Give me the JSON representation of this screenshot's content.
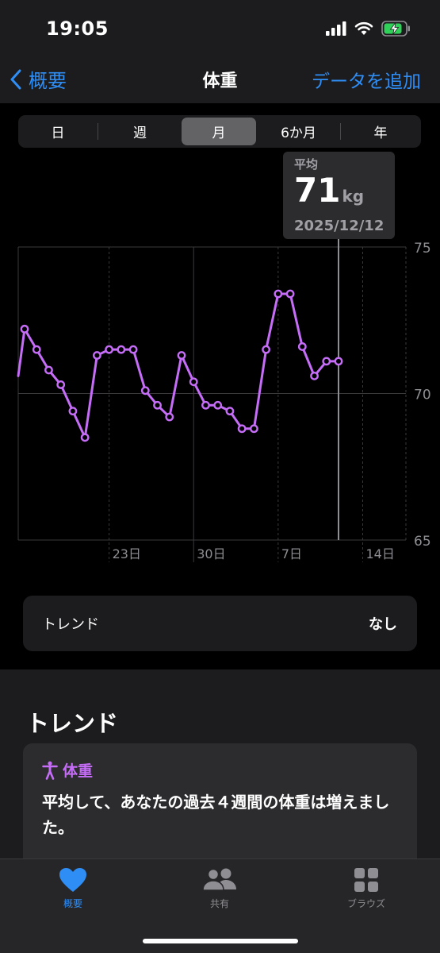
{
  "status_bar": {
    "time": "19:05"
  },
  "nav": {
    "back_label": "概要",
    "title": "体重",
    "add_label": "データを追加"
  },
  "segments": [
    {
      "label": "日",
      "active": false
    },
    {
      "label": "週",
      "active": false
    },
    {
      "label": "月",
      "active": true
    },
    {
      "label": "6か月",
      "active": false
    },
    {
      "label": "年",
      "active": false
    }
  ],
  "tooltip": {
    "label": "平均",
    "value": "71",
    "unit": "kg",
    "date": "2025/12/12"
  },
  "colors": {
    "accent": "#2f8ef5",
    "series": "#c56df7",
    "background": "#000000",
    "card": "#1c1c1e"
  },
  "chart_data": {
    "type": "line",
    "x_unit": "day",
    "x": [
      "2025-11-16",
      "2025-11-17",
      "2025-11-18",
      "2025-11-19",
      "2025-11-20",
      "2025-11-21",
      "2025-11-22",
      "2025-11-23",
      "2025-11-24",
      "2025-11-25",
      "2025-11-26",
      "2025-11-27",
      "2025-11-28",
      "2025-11-29",
      "2025-11-30",
      "2025-12-01",
      "2025-12-02",
      "2025-12-03",
      "2025-12-04",
      "2025-12-05",
      "2025-12-06",
      "2025-12-07",
      "2025-12-08",
      "2025-12-09",
      "2025-12-10",
      "2025-12-11",
      "2025-12-12"
    ],
    "series": [
      {
        "values": [
          72.2,
          71.5,
          70.8,
          70.3,
          69.4,
          68.5,
          71.3,
          71.5,
          71.5,
          71.5,
          70.1,
          69.6,
          69.2,
          71.3,
          70.4,
          69.6,
          69.6,
          69.4,
          68.8,
          68.8,
          71.5,
          73.4,
          73.4,
          71.6,
          70.6,
          71.1,
          71.1
        ]
      }
    ],
    "ylim": [
      65,
      75
    ],
    "y_ticks": [
      "75",
      "70",
      "65"
    ],
    "x_tick_labels": [
      "23日",
      "30日",
      "7日",
      "14日"
    ],
    "selected_x": "2025-12-12",
    "grid": true
  },
  "trend_card": {
    "label": "トレンド",
    "value": "なし"
  },
  "trends_section": {
    "title": "トレンド",
    "card_label": "体重",
    "card_text": "平均して、あなたの過去４週間の体重は増えました。"
  },
  "tab_bar": [
    {
      "label": "概要",
      "icon": "heart-icon",
      "active": true
    },
    {
      "label": "共有",
      "icon": "people-icon",
      "active": false
    },
    {
      "label": "ブラウズ",
      "icon": "grid-icon",
      "active": false
    }
  ]
}
